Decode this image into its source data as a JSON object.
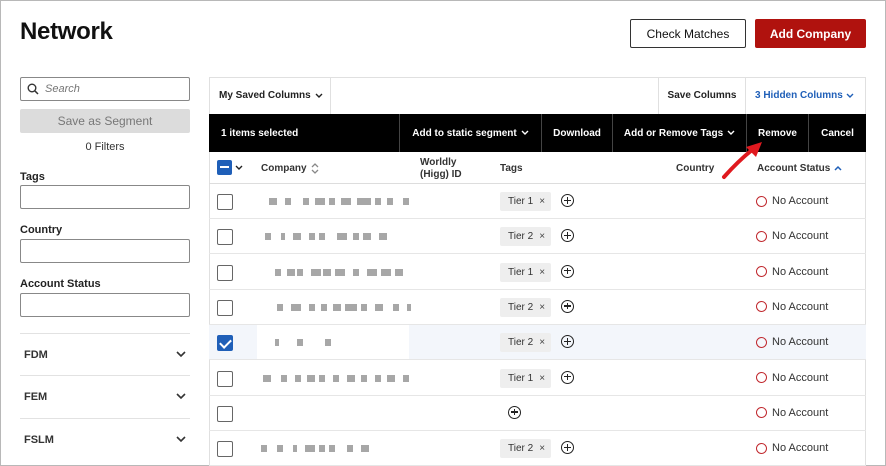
{
  "header": {
    "title": "Network",
    "check_matches_label": "Check Matches",
    "add_company_label": "Add Company"
  },
  "sidebar": {
    "search_placeholder": "Search",
    "save_segment_label": "Save as Segment",
    "filters_count": "0 Filters",
    "tags_label": "Tags",
    "country_label": "Country",
    "account_status_label": "Account Status",
    "accordions": [
      {
        "label": "FDM"
      },
      {
        "label": "FEM"
      },
      {
        "label": "FSLM"
      }
    ]
  },
  "toolbar": {
    "saved_columns_label": "My Saved Columns",
    "save_columns_label": "Save Columns",
    "hidden_columns_label": "3 Hidden Columns"
  },
  "actionbar": {
    "selected_text": "1 items selected",
    "add_static_label": "Add to static segment",
    "download_label": "Download",
    "add_remove_tags_label": "Add or Remove Tags",
    "remove_label": "Remove",
    "cancel_label": "Cancel"
  },
  "table": {
    "columns": {
      "company": "Company",
      "worldly_line1": "Worldly",
      "worldly_line2": "(Higg) ID",
      "tags": "Tags",
      "country": "Country",
      "account_status": "Account Status"
    },
    "rows": [
      {
        "checked": false,
        "tag": "Tier 1",
        "status": "No Account"
      },
      {
        "checked": false,
        "tag": "Tier 2",
        "status": "No Account"
      },
      {
        "checked": false,
        "tag": "Tier 1",
        "status": "No Account"
      },
      {
        "checked": false,
        "tag": "Tier 2",
        "status": "No Account"
      },
      {
        "checked": true,
        "tag": "Tier 2",
        "status": "No Account"
      },
      {
        "checked": false,
        "tag": "Tier 1",
        "status": "No Account"
      },
      {
        "checked": false,
        "tag": "",
        "status": "No Account"
      },
      {
        "checked": false,
        "tag": "Tier 2",
        "status": "No Account"
      }
    ]
  },
  "colors": {
    "brand_red": "#b0120e",
    "link_blue": "#1f5fb8",
    "status_red": "#c0272d",
    "annotation_arrow": "#e0191f"
  }
}
